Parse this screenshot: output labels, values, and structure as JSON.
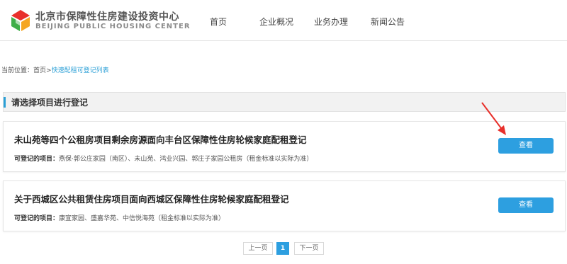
{
  "header": {
    "brand_cn": "北京市保障性住房建设投资中心",
    "brand_en": "BEIJING PUBLIC HOUSING CENTER",
    "nav": [
      {
        "label": "首页"
      },
      {
        "label": "企业概况"
      },
      {
        "label": "业务办理"
      },
      {
        "label": "新闻公告"
      }
    ]
  },
  "breadcrumb": {
    "prefix": "当前位置：",
    "home": "首页",
    "sep": ">",
    "current": "快速配租可登记列表"
  },
  "section": {
    "title": "请选择项目进行登记"
  },
  "projects": [
    {
      "title": "未山苑等四个公租房项目剩余房源面向丰台区保障性住房轮候家庭配租登记",
      "desc_label": "可登记的项目：",
      "desc_value": "燕保·郭公庄家园（南区）、未山苑、鸿业兴园、郭庄子家园公租房（租金标准以实际为准）",
      "button": "查看"
    },
    {
      "title": "关于西城区公共租赁住房项目面向西城区保障性住房轮候家庭配租登记",
      "desc_label": "可登记的项目：",
      "desc_value": "康宣家园、盛嘉华苑、中信悦海苑（租金标准以实际为准）",
      "button": "查看"
    }
  ],
  "pagination": {
    "prev": "上一页",
    "current": "1",
    "next": "下一页"
  },
  "colors": {
    "accent": "#2d9fe0",
    "arrow": "#e8302b"
  }
}
